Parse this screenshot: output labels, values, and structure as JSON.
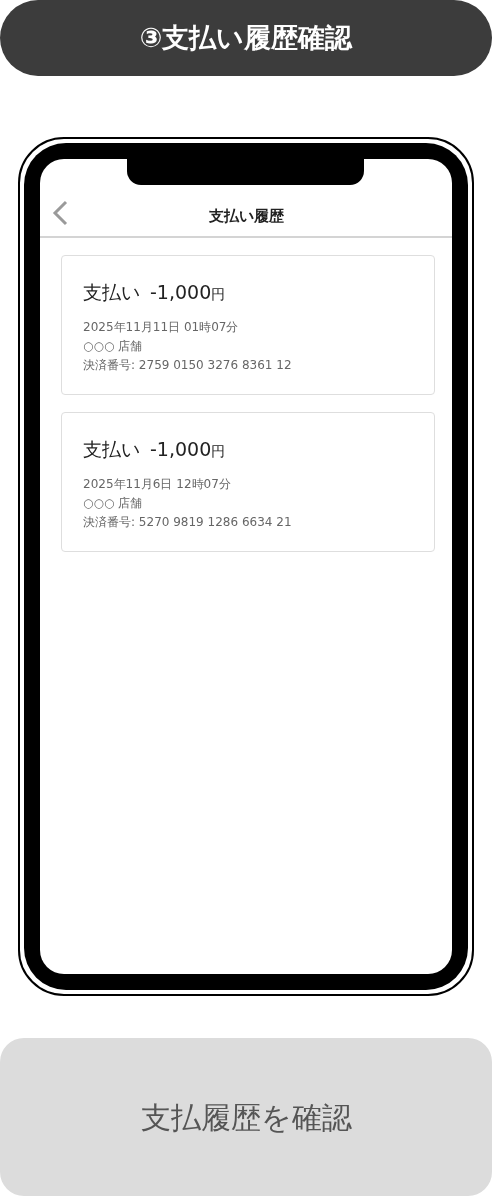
{
  "step_title": "③支払い履歴確認",
  "screen": {
    "title": "支払い履歴",
    "payments": [
      {
        "label": "支払い",
        "amount": "-1,000",
        "currency": "円",
        "datetime": "2025年11月11日 01時07分",
        "store": "○○○ 店舗",
        "transaction": "決済番号: 2759 0150 3276 8361 12"
      },
      {
        "label": "支払い",
        "amount": "-1,000",
        "currency": "円",
        "datetime": "2025年11月6日 12時07分",
        "store": "○○○ 店舗",
        "transaction": "決済番号: 5270 9819 1286 6634 21"
      }
    ]
  },
  "action_button": "支払履歴を確認"
}
